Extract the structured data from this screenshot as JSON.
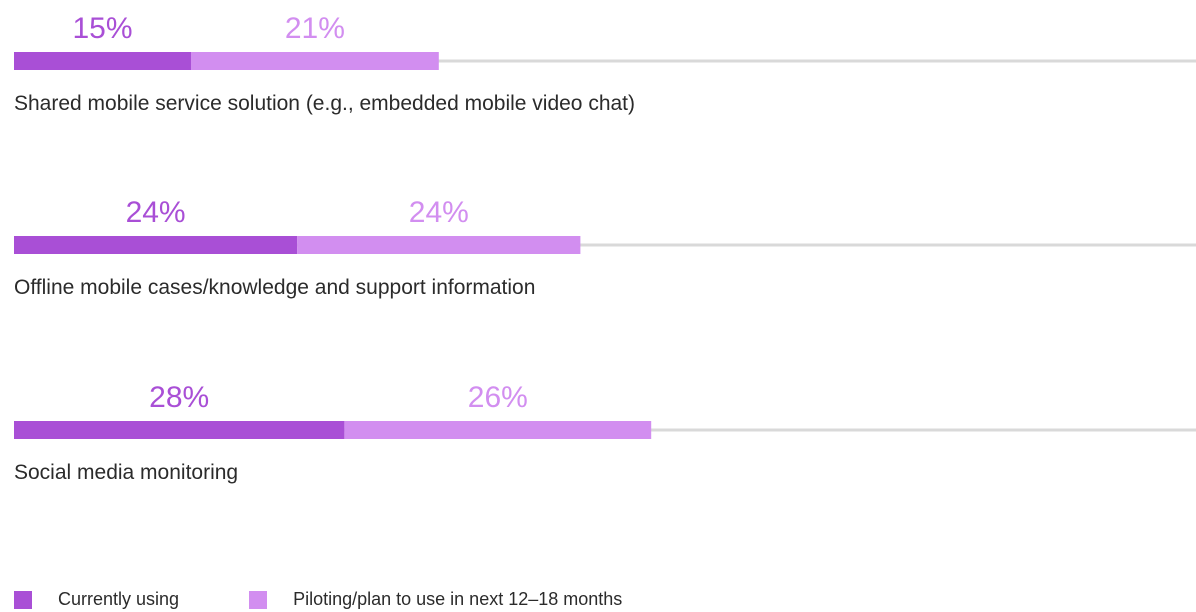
{
  "chart_data": {
    "type": "bar",
    "orientation": "horizontal",
    "stacked": true,
    "categories": [
      "Shared mobile service solution (e.g., embedded mobile video chat)",
      "Offline mobile cases/knowledge and support information",
      "Social media monitoring"
    ],
    "series": [
      {
        "name": "Currently using",
        "values": [
          15,
          24,
          28
        ],
        "labels": [
          "15%",
          "24%",
          "28%"
        ],
        "color": "#a94fd6"
      },
      {
        "name": "Piloting/plan to use in next 12–18 months",
        "values": [
          21,
          24,
          26
        ],
        "labels": [
          "21%",
          "24%",
          "26%"
        ],
        "color": "#d28ef0"
      }
    ],
    "unit": "%",
    "xlim": [
      0,
      100
    ],
    "grid": false,
    "legend_position": "bottom-left",
    "track_color": "#d9d9d9",
    "label_color": "#2b2b2b"
  },
  "legend": {
    "current": "Currently using",
    "planned": "Piloting/plan to use in next 12–18 months"
  }
}
